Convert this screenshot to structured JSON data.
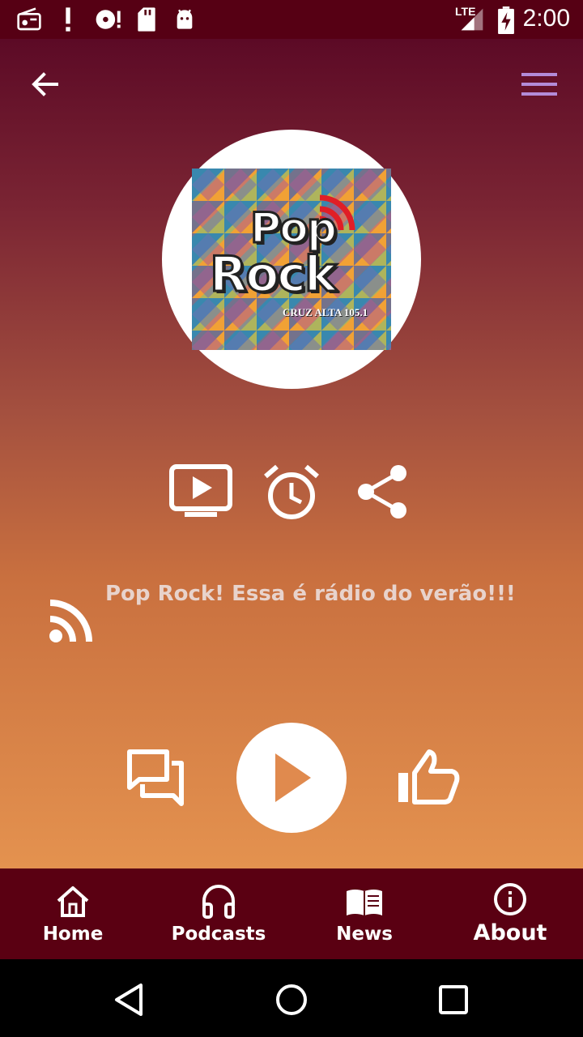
{
  "status_bar": {
    "time": "2:00",
    "network": "LTE",
    "icons": [
      "radio-icon",
      "alert-icon",
      "disc-alert-icon",
      "sd-card-icon",
      "android-icon",
      "signal-icon",
      "battery-charging-icon"
    ]
  },
  "header": {
    "back_icon": "arrow-left-icon",
    "menu_icon": "hamburger-menu-icon"
  },
  "logo": {
    "line1": "Pop",
    "line2": "Rock",
    "subtitle": "CRUZ ALTA 105.1"
  },
  "actions": {
    "icons": [
      "tv-play-icon",
      "alarm-clock-icon",
      "share-icon"
    ]
  },
  "now_playing": {
    "text": "Pop Rock! Essa é rádio do verão!!!"
  },
  "player": {
    "chat_icon": "chat-icon",
    "play_icon": "play-icon",
    "like_icon": "thumbs-up-icon"
  },
  "bottom_nav": {
    "items": [
      {
        "label": "Home",
        "icon": "home-icon"
      },
      {
        "label": "Podcasts",
        "icon": "headphones-icon"
      },
      {
        "label": "News",
        "icon": "book-icon"
      },
      {
        "label": "About",
        "icon": "info-icon"
      }
    ]
  },
  "system_nav": {
    "icons": [
      "back-triangle-icon",
      "home-circle-icon",
      "recents-square-icon"
    ]
  },
  "colors": {
    "status_bar": "#560014",
    "nav_bar": "#5a0012",
    "gradient_top": "#5c0a26",
    "gradient_bottom": "#e4924f",
    "menu_accent": "#b38bd8"
  }
}
